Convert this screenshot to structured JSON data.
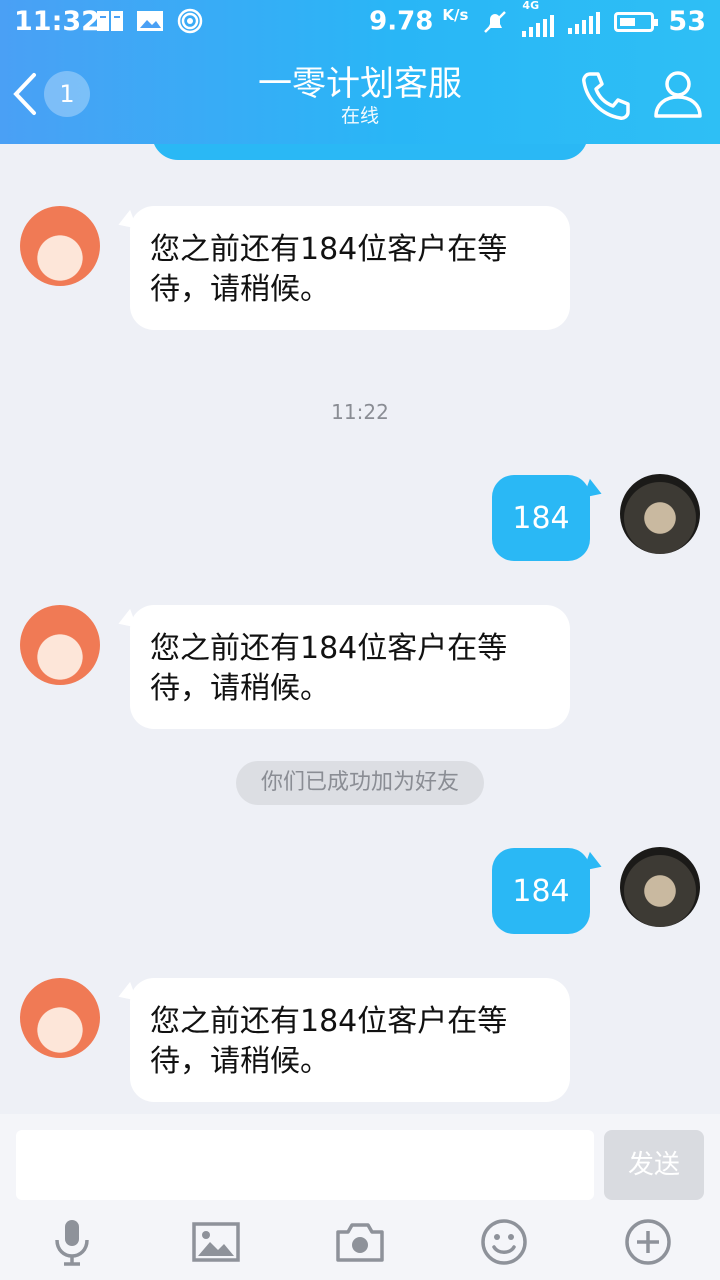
{
  "status_bar": {
    "time": "11:32",
    "speed": "9.78",
    "speed_unit": "K/s",
    "network": "4G",
    "battery": "53",
    "battery_level": 0.53
  },
  "header": {
    "back_badge": "1",
    "title": "一零计划客服",
    "subtitle": "在线"
  },
  "messages": [
    {
      "type": "incoming",
      "text": "您之前还有184位客户在等待，请稍候。"
    },
    {
      "type": "time",
      "text": "11:22"
    },
    {
      "type": "outgoing",
      "text": "184"
    },
    {
      "type": "incoming",
      "text": "您之前还有184位客户在等待，请稍候。"
    },
    {
      "type": "system",
      "text": "你们已成功加为好友"
    },
    {
      "type": "outgoing",
      "text": "184"
    },
    {
      "type": "incoming",
      "text": "您之前还有184位客户在等待，请稍候。"
    }
  ],
  "input": {
    "placeholder": "",
    "send_label": "发送"
  },
  "toolbar": [
    "microphone-icon",
    "image-icon",
    "camera-icon",
    "emoji-icon",
    "plus-icon"
  ],
  "colors": {
    "header_start": "#4aa0f5",
    "header_end": "#2ebff5",
    "outgoing_bubble": "#2ab8f5",
    "background": "#eef0f6"
  }
}
